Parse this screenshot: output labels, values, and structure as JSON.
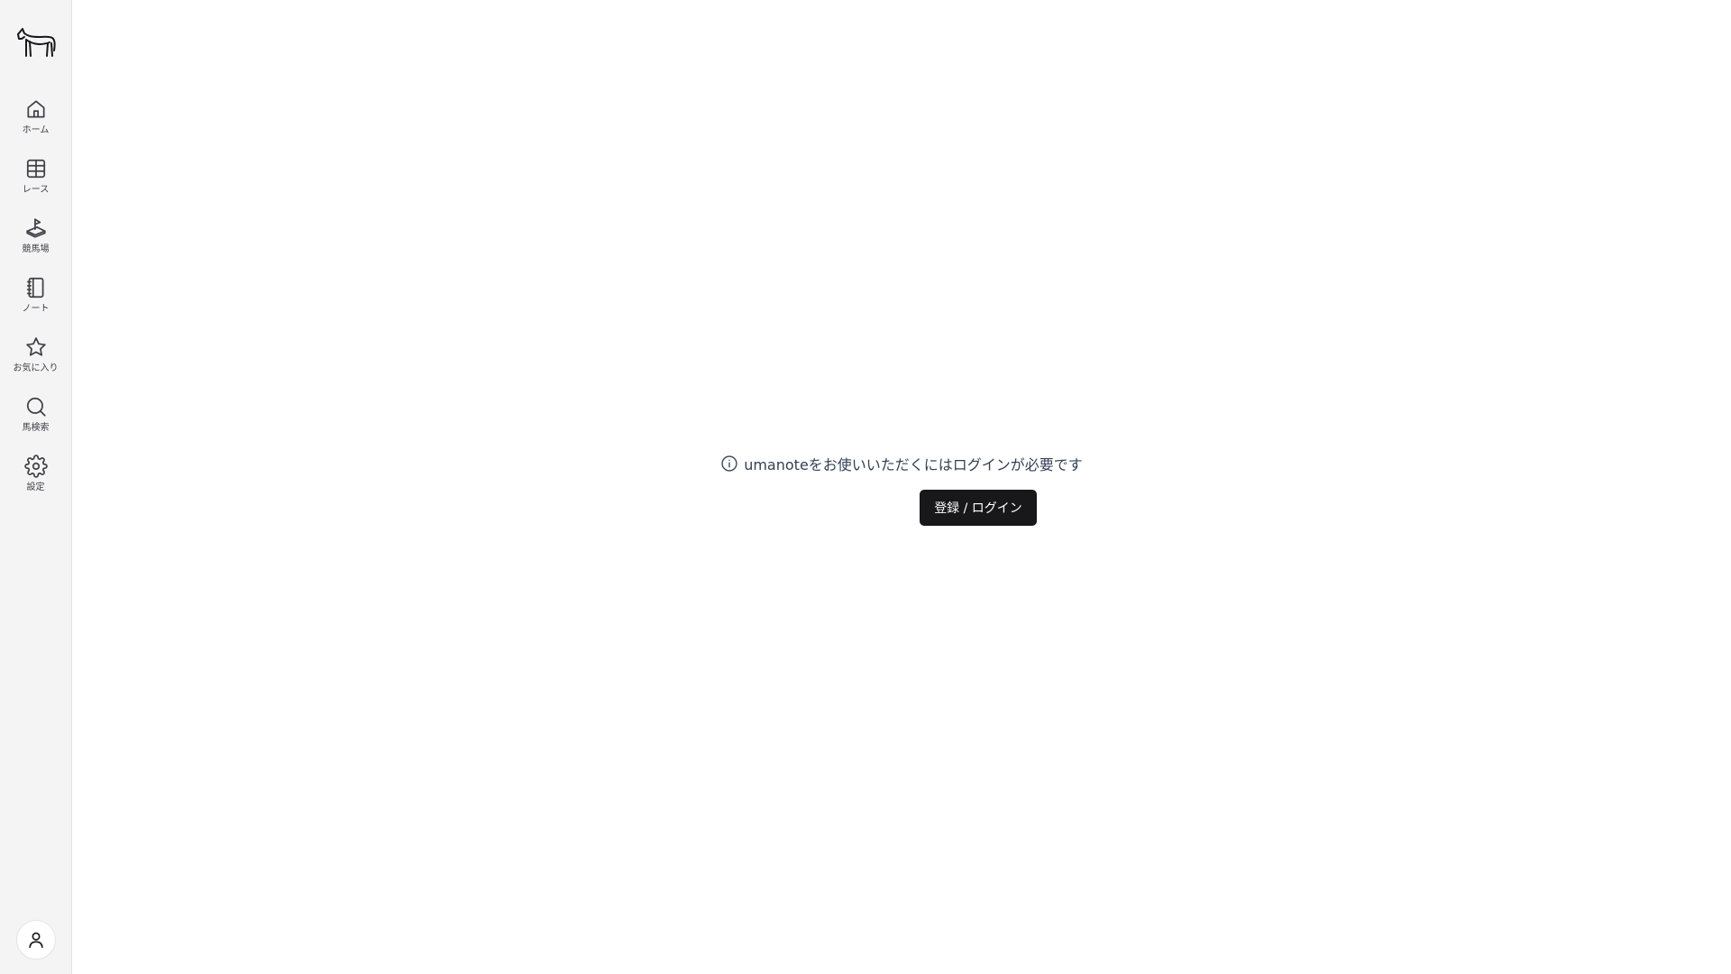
{
  "sidebar": {
    "logo_icon": "horse-logo-icon",
    "items": [
      {
        "label": "ホーム",
        "icon": "home-icon"
      },
      {
        "label": "レース",
        "icon": "table-icon"
      },
      {
        "label": "競馬場",
        "icon": "racecourse-icon"
      },
      {
        "label": "ノート",
        "icon": "notebook-icon"
      },
      {
        "label": "お気に入り",
        "icon": "star-icon"
      },
      {
        "label": "馬検索",
        "icon": "search-icon"
      },
      {
        "label": "設定",
        "icon": "gear-icon"
      }
    ],
    "account_icon": "user-icon"
  },
  "main": {
    "notice_text": "umanoteをお使いいただくにはログインが必要です",
    "notice_icon": "info-icon",
    "login_button_label": "登録 / ログイン"
  },
  "colors": {
    "sidebar_bg": "#f4f4f5",
    "button_bg": "#18181b",
    "text": "#334155"
  }
}
